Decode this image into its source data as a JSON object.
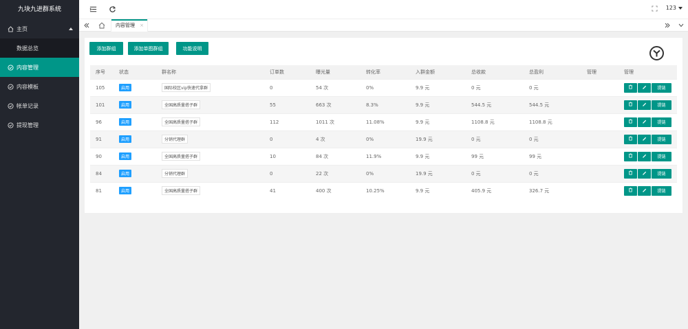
{
  "app": {
    "title": "九块九进群系统"
  },
  "sidebar": {
    "home_label": "主页",
    "sub_items": [
      {
        "label": "数据总览"
      }
    ],
    "items": [
      {
        "label": "内容管理",
        "active": true,
        "icon": "check-circle-icon"
      },
      {
        "label": "内容模板",
        "active": false,
        "icon": "check-circle-icon"
      },
      {
        "label": "帐单记录",
        "active": false,
        "icon": "check-circle-icon"
      },
      {
        "label": "提现管理",
        "active": false,
        "icon": "check-circle-icon"
      }
    ]
  },
  "header": {
    "user": "123"
  },
  "tabs": {
    "active_label": "内容管理",
    "close_glyph": "×"
  },
  "toolbar": {
    "add_group": "添加群组",
    "add_single_group": "添加单图群组",
    "feature_help": "功能说明"
  },
  "table": {
    "columns": [
      "序号",
      "状态",
      "群名称",
      "订单数",
      "曝光量",
      "转化率",
      "入群金额",
      "总收款",
      "总盈利",
      "管理",
      "管理"
    ],
    "rows": [
      {
        "id": "105",
        "status": "启用",
        "name": "国际校区vip快速代拿群",
        "orders": "0",
        "views": "54 次",
        "rate": "0%",
        "fee": "9.9 元",
        "revenue": "0 元",
        "profit": "0 元"
      },
      {
        "id": "101",
        "status": "启用",
        "name": "全国高质量搭子群",
        "orders": "55",
        "views": "663 次",
        "rate": "8.3%",
        "fee": "9.9 元",
        "revenue": "544.5 元",
        "profit": "544.5 元"
      },
      {
        "id": "96",
        "status": "启用",
        "name": "全国高质量搭子群",
        "orders": "112",
        "views": "1011 次",
        "rate": "11.08%",
        "fee": "9.9 元",
        "revenue": "1108.8 元",
        "profit": "1108.8 元"
      },
      {
        "id": "91",
        "status": "启用",
        "name": "分销代理群",
        "orders": "0",
        "views": "4 次",
        "rate": "0%",
        "fee": "19.9 元",
        "revenue": "0 元",
        "profit": "0 元"
      },
      {
        "id": "90",
        "status": "启用",
        "name": "全国高质量搭子群",
        "orders": "10",
        "views": "84 次",
        "rate": "11.9%",
        "fee": "9.9 元",
        "revenue": "99 元",
        "profit": "99 元"
      },
      {
        "id": "84",
        "status": "启用",
        "name": "分销代理群",
        "orders": "0",
        "views": "22 次",
        "rate": "0%",
        "fee": "19.9 元",
        "revenue": "0 元",
        "profit": "0 元"
      },
      {
        "id": "81",
        "status": "启用",
        "name": "全国高质量搭子群",
        "orders": "41",
        "views": "400 次",
        "rate": "10.25%",
        "fee": "9.9 元",
        "revenue": "405.9 元",
        "profit": "326.7 元"
      }
    ],
    "row_action_label": "提链"
  },
  "colors": {
    "sidebar": "#23262e",
    "accent": "#009688",
    "badge": "#1e9fff"
  }
}
